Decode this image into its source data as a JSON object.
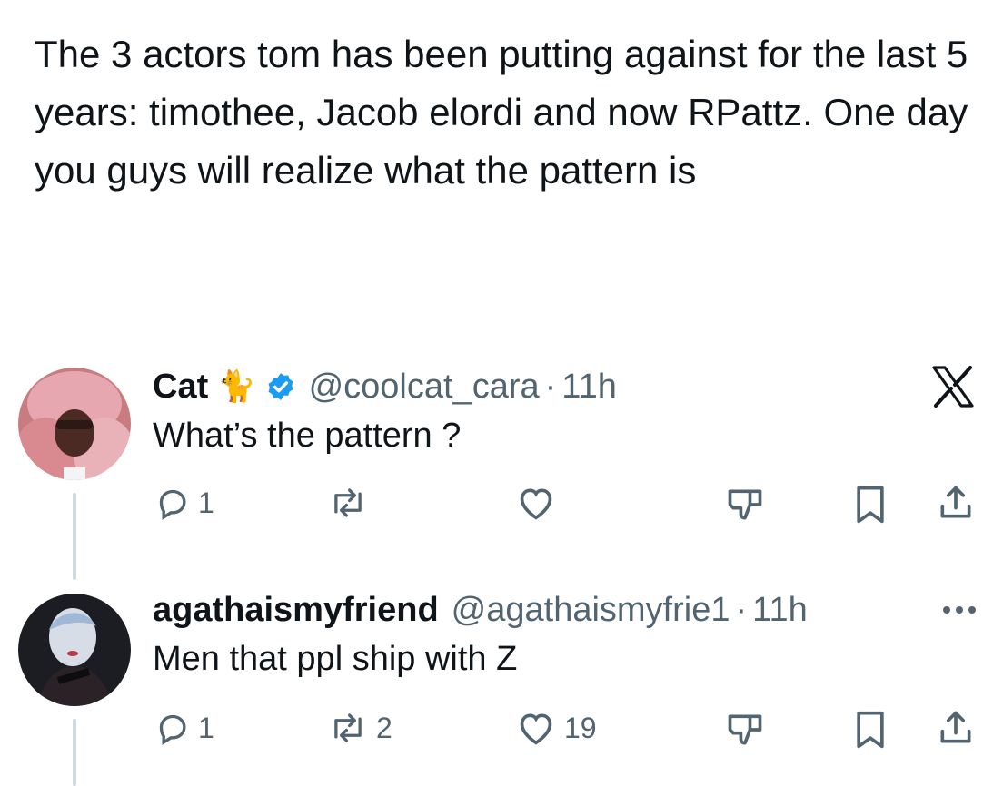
{
  "quoted_post": {
    "text": "The 3 actors tom has been putting against for the last 5 years: timothee, Jacob elordi and now RPattz. One day you guys will realize what the pattern is"
  },
  "replies": [
    {
      "display_name": "Cat",
      "emoji": "🐈",
      "verified": true,
      "handle": "@coolcat_cara",
      "separator": "·",
      "time": "11h",
      "text": "What’s the pattern ?",
      "replies_count": "1",
      "reposts_count": "",
      "likes_count": "",
      "corner_icon": "x-logo-icon"
    },
    {
      "display_name": "agathaismyfriend",
      "verified": false,
      "handle": "@agathaismyfrie1",
      "separator": "·",
      "time": "11h",
      "text": "Men that ppl ship with Z",
      "replies_count": "1",
      "reposts_count": "2",
      "likes_count": "19",
      "corner_icon": "more-options-icon"
    }
  ],
  "colors": {
    "text": "#0f1419",
    "secondary": "#536471",
    "verified": "#1d9bf0",
    "thread_line": "#cfd9de"
  }
}
